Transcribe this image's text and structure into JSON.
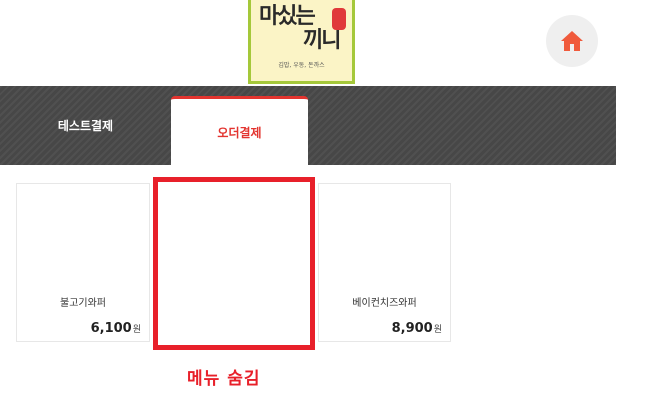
{
  "logo": {
    "line1": "마싰는",
    "line2": "끼니",
    "subtitle": "김밥, 우동, 돈까스"
  },
  "header": {
    "home_icon": "home-icon",
    "home_color": "#f05a3c"
  },
  "tabs": [
    {
      "label": "테스트결제",
      "active": false
    },
    {
      "label": "오더결제",
      "active": true
    }
  ],
  "menu_items": [
    {
      "name": "불고기와퍼",
      "price": "6,100",
      "currency": "원"
    },
    {
      "name": "",
      "price": "",
      "currency": ""
    },
    {
      "name": "베이컨치즈와퍼",
      "price": "8,900",
      "currency": "원"
    }
  ],
  "annotation": {
    "label": "메뉴 숨김",
    "color": "#e8202a"
  },
  "colors": {
    "accent": "#e3342f",
    "tabbar": "#474747"
  }
}
